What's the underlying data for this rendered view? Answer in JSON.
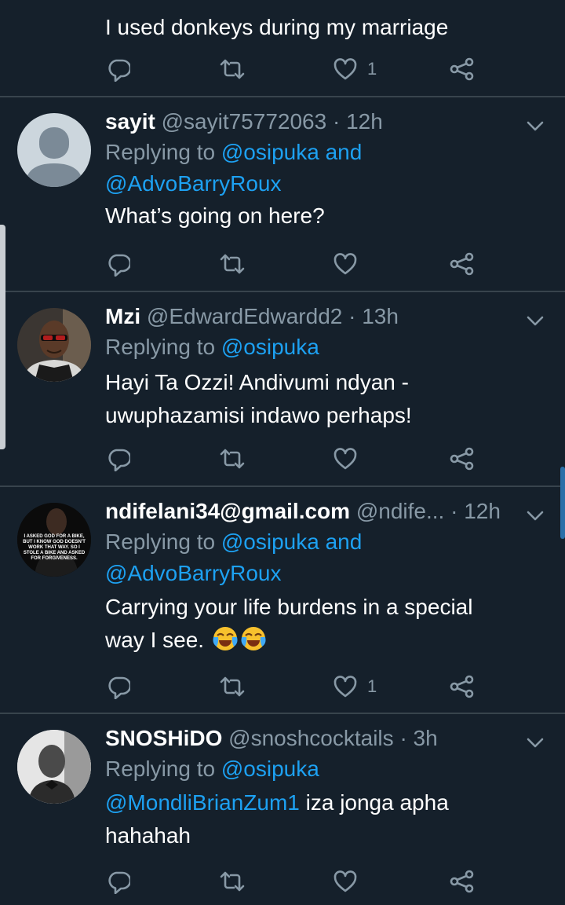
{
  "partial_tweet": {
    "text": "I used donkeys during my marriage",
    "like_count": "1"
  },
  "tweets": [
    {
      "name": "sayit",
      "handle": "@sayit75772063",
      "sep": "·",
      "time": "12h",
      "replying_prefix": "Replying to",
      "mention_line1": "@osipuka and",
      "mention_line2": "@AdvoBarryRoux",
      "text_line1": "What’s going on here?"
    },
    {
      "name": "Mzi",
      "handle": "@EdwardEdwardd2",
      "sep": "·",
      "time": "13h",
      "replying_prefix": "Replying to",
      "mention_line1": "@osipuka",
      "text_line1": "Hayi Ta Ozzi! Andivumi ndyan -",
      "text_line2": "uwuphazamisi indawo perhaps!"
    },
    {
      "name": "ndifelani34@gmail.com",
      "handle": "@ndife...",
      "sep": "·",
      "time": "12h",
      "replying_prefix": "Replying to",
      "mention_line1": "@osipuka and",
      "mention_line2": "@AdvoBarryRoux",
      "text_line1": "Carrying your life burdens in a special",
      "text_line2": "way I see.",
      "like_count": "1",
      "avatar_caption": "I ASKED GOD FOR A BIKE, BUT I KNOW GOD DOESN'T WORK THAT WAY. SO I STOLE A BIKE AND ASKED FOR FORGIVENESS."
    },
    {
      "name": "SNOSHiDO",
      "handle": "@snoshcocktails",
      "sep": "·",
      "time": "3h",
      "replying_prefix": "Replying to",
      "mention_line1": "@osipuka",
      "text_mention": "@MondliBrianZum1",
      "text_line1_rest": " iza jonga apha",
      "text_line2": "hahahah"
    }
  ],
  "icons": {
    "reply": "reply-icon",
    "retweet": "retweet-icon",
    "like": "heart-icon",
    "share": "share-icon",
    "more": "chevron-down-icon"
  },
  "colors": {
    "background": "#15202b",
    "accent": "#1da1f2",
    "muted": "#8899a6",
    "divider": "#38444d"
  }
}
